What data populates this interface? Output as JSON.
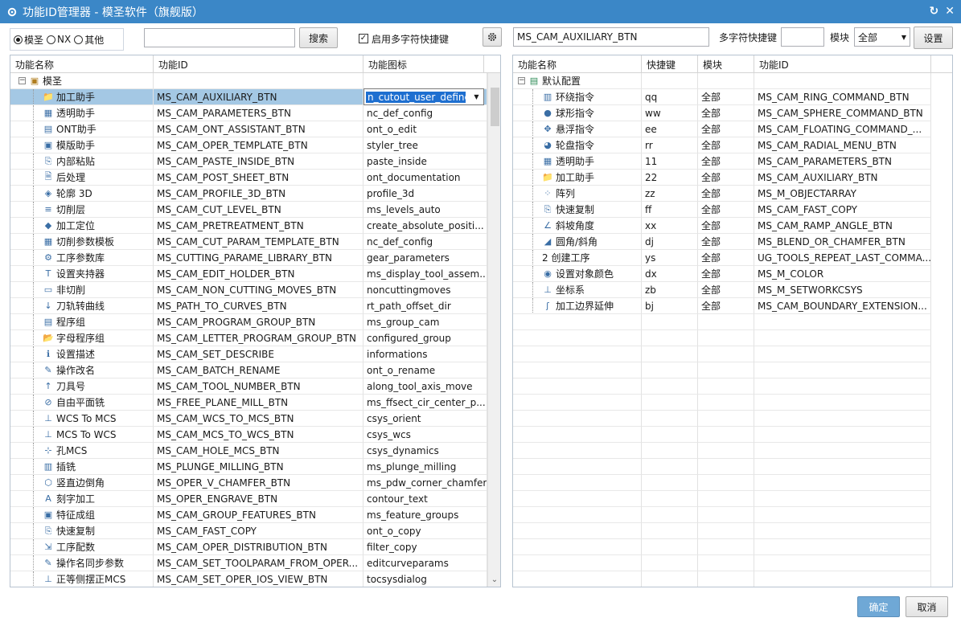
{
  "window": {
    "title": "功能ID管理器 - 模圣软件（旗舰版）",
    "refresh_glyph": "↻",
    "close_glyph": "✕"
  },
  "top": {
    "radios": [
      {
        "label": "模圣",
        "checked": true
      },
      {
        "label": "NX",
        "checked": false
      },
      {
        "label": "其他",
        "checked": false
      }
    ],
    "search_value": "",
    "search_button": "搜索",
    "multi_char_checkbox_label": "启用多字符快捷键",
    "multi_char_checked": true,
    "right_id_value": "MS_CAM_AUXILIARY_BTN",
    "shortcut_label": "多字符快捷键",
    "shortcut_value": "",
    "module_label": "模块",
    "module_value": "全部",
    "settings_button": "设置"
  },
  "left_table": {
    "headers": [
      "功能名称",
      "功能ID",
      "功能图标"
    ],
    "root_label": "模圣",
    "editing_value": "n_cutout_user_defined",
    "rows": [
      {
        "name": "加工助手",
        "id": "MS_CAM_AUXILIARY_BTN",
        "icon": "n_cutout_user_defined",
        "ico": "📁",
        "selected": true
      },
      {
        "name": "透明助手",
        "id": "MS_CAM_PARAMETERS_BTN",
        "icon": "nc_def_config",
        "ico": "▦"
      },
      {
        "name": "ONT助手",
        "id": "MS_CAM_ONT_ASSISTANT_BTN",
        "icon": "ont_o_edit",
        "ico": "▤"
      },
      {
        "name": "模版助手",
        "id": "MS_CAM_OPER_TEMPLATE_BTN",
        "icon": "styler_tree",
        "ico": "▣"
      },
      {
        "name": "内部粘贴",
        "id": "MS_CAM_PASTE_INSIDE_BTN",
        "icon": "paste_inside",
        "ico": "⎘"
      },
      {
        "name": "后处理",
        "id": "MS_CAM_POST_SHEET_BTN",
        "icon": "ont_documentation",
        "ico": "🗎"
      },
      {
        "name": "轮廓 3D",
        "id": "MS_CAM_PROFILE_3D_BTN",
        "icon": "profile_3d",
        "ico": "◈"
      },
      {
        "name": "切削层",
        "id": "MS_CAM_CUT_LEVEL_BTN",
        "icon": "ms_levels_auto",
        "ico": "≡"
      },
      {
        "name": "加工定位",
        "id": "MS_CAM_PRETREATMENT_BTN",
        "icon": "create_absolute_positi...",
        "ico": "◆"
      },
      {
        "name": "切削参数模板",
        "id": "MS_CAM_CUT_PARAM_TEMPLATE_BTN",
        "icon": "nc_def_config",
        "ico": "▦"
      },
      {
        "name": "工序参数库",
        "id": "MS_CUTTING_PARAME_LIBRARY_BTN",
        "icon": "gear_parameters",
        "ico": "⚙"
      },
      {
        "name": "设置夹持器",
        "id": "MS_CAM_EDIT_HOLDER_BTN",
        "icon": "ms_display_tool_assem...",
        "ico": "T"
      },
      {
        "name": "非切削",
        "id": "MS_CAM_NON_CUTTING_MOVES_BTN",
        "icon": "noncuttingmoves",
        "ico": "▭"
      },
      {
        "name": "刀轨转曲线",
        "id": "MS_PATH_TO_CURVES_BTN",
        "icon": "rt_path_offset_dir",
        "ico": "↓"
      },
      {
        "name": "程序组",
        "id": "MS_CAM_PROGRAM_GROUP_BTN",
        "icon": "ms_group_cam",
        "ico": "▤"
      },
      {
        "name": "字母程序组",
        "id": "MS_CAM_LETTER_PROGRAM_GROUP_BTN",
        "icon": "configured_group",
        "ico": "📂"
      },
      {
        "name": "设置描述",
        "id": "MS_CAM_SET_DESCRIBE",
        "icon": "informations",
        "ico": "ℹ"
      },
      {
        "name": "操作改名",
        "id": "MS_CAM_BATCH_RENAME",
        "icon": "ont_o_rename",
        "ico": "✎"
      },
      {
        "name": "刀具号",
        "id": "MS_CAM_TOOL_NUMBER_BTN",
        "icon": "along_tool_axis_move",
        "ico": "↑"
      },
      {
        "name": "自由平面铣",
        "id": "MS_FREE_PLANE_MILL_BTN",
        "icon": "ms_ffsect_cir_center_p...",
        "ico": "⊘"
      },
      {
        "name": "WCS To MCS",
        "id": "MS_CAM_WCS_TO_MCS_BTN",
        "icon": "csys_orient",
        "ico": "⊥"
      },
      {
        "name": "MCS To WCS",
        "id": "MS_CAM_MCS_TO_WCS_BTN",
        "icon": "csys_wcs",
        "ico": "⊥"
      },
      {
        "name": "孔MCS",
        "id": "MS_CAM_HOLE_MCS_BTN",
        "icon": "csys_dynamics",
        "ico": "⊹"
      },
      {
        "name": "插铣",
        "id": "MS_PLUNGE_MILLING_BTN",
        "icon": "ms_plunge_milling",
        "ico": "▥"
      },
      {
        "name": "竖直边倒角",
        "id": "MS_OPER_V_CHAMFER_BTN",
        "icon": "ms_pdw_corner_chamfer",
        "ico": "⬡"
      },
      {
        "name": "刻字加工",
        "id": "MS_OPER_ENGRAVE_BTN",
        "icon": "contour_text",
        "ico": "A"
      },
      {
        "name": "特征成组",
        "id": "MS_CAM_GROUP_FEATURES_BTN",
        "icon": "ms_feature_groups",
        "ico": "▣"
      },
      {
        "name": "快速复制",
        "id": "MS_CAM_FAST_COPY",
        "icon": "ont_o_copy",
        "ico": "⎘"
      },
      {
        "name": "工序配数",
        "id": "MS_CAM_OPER_DISTRIBUTION_BTN",
        "icon": "filter_copy",
        "ico": "⇲"
      },
      {
        "name": "操作名同步参数",
        "id": "MS_CAM_SET_TOOLPARAM_FROM_OPER...",
        "icon": "editcurveparams",
        "ico": "✎"
      },
      {
        "name": "正等侧摆正MCS",
        "id": "MS_CAM_SET_OPER_IOS_VIEW_BTN",
        "icon": "tocsysdialog",
        "ico": "⊥"
      }
    ]
  },
  "right_table": {
    "headers": [
      "功能名称",
      "快捷键",
      "模块",
      "功能ID"
    ],
    "root_label": "默认配置",
    "rows": [
      {
        "name": "环绕指令",
        "key": "qq",
        "module": "全部",
        "id": "MS_CAM_RING_COMMAND_BTN",
        "ico": "▥"
      },
      {
        "name": "球形指令",
        "key": "ww",
        "module": "全部",
        "id": "MS_CAM_SPHERE_COMMAND_BTN",
        "ico": "●"
      },
      {
        "name": "悬浮指令",
        "key": "ee",
        "module": "全部",
        "id": "MS_CAM_FLOATING_COMMAND_...",
        "ico": "✥"
      },
      {
        "name": "轮盘指令",
        "key": "rr",
        "module": "全部",
        "id": "MS_CAM_RADIAL_MENU_BTN",
        "ico": "◕"
      },
      {
        "name": "透明助手",
        "key": "11",
        "module": "全部",
        "id": "MS_CAM_PARAMETERS_BTN",
        "ico": "▦"
      },
      {
        "name": "加工助手",
        "key": "22",
        "module": "全部",
        "id": "MS_CAM_AUXILIARY_BTN",
        "ico": "📁"
      },
      {
        "name": "阵列",
        "key": "zz",
        "module": "全部",
        "id": "MS_M_OBJECTARRAY",
        "ico": "⁘"
      },
      {
        "name": "快速复制",
        "key": "ff",
        "module": "全部",
        "id": "MS_CAM_FAST_COPY",
        "ico": "⎘"
      },
      {
        "name": "斜坡角度",
        "key": "xx",
        "module": "全部",
        "id": "MS_CAM_RAMP_ANGLE_BTN",
        "ico": "∠"
      },
      {
        "name": "圆角/斜角",
        "key": "dj",
        "module": "全部",
        "id": "MS_BLEND_OR_CHAMFER_BTN",
        "ico": "◢"
      },
      {
        "name": "2 创建工序",
        "key": "ys",
        "module": "全部",
        "id": "UG_TOOLS_REPEAT_LAST_COMMA...",
        "ico": ""
      },
      {
        "name": "设置对象颜色",
        "key": "dx",
        "module": "全部",
        "id": "MS_M_COLOR",
        "ico": "◉"
      },
      {
        "name": "坐标系",
        "key": "zb",
        "module": "全部",
        "id": "MS_M_SETWORKCSYS",
        "ico": "⊥"
      },
      {
        "name": "加工边界延伸",
        "key": "bj",
        "module": "全部",
        "id": "MS_CAM_BOUNDARY_EXTENSION...",
        "ico": "ʃ"
      }
    ]
  },
  "footer": {
    "ok_button": "确定",
    "cancel_button": "取消"
  },
  "colors": {
    "title_bar": "#3b87c7",
    "selection": "#a4c8e4",
    "edit_highlight": "#1e6fd0",
    "ok_button": "#6fa8d6"
  }
}
